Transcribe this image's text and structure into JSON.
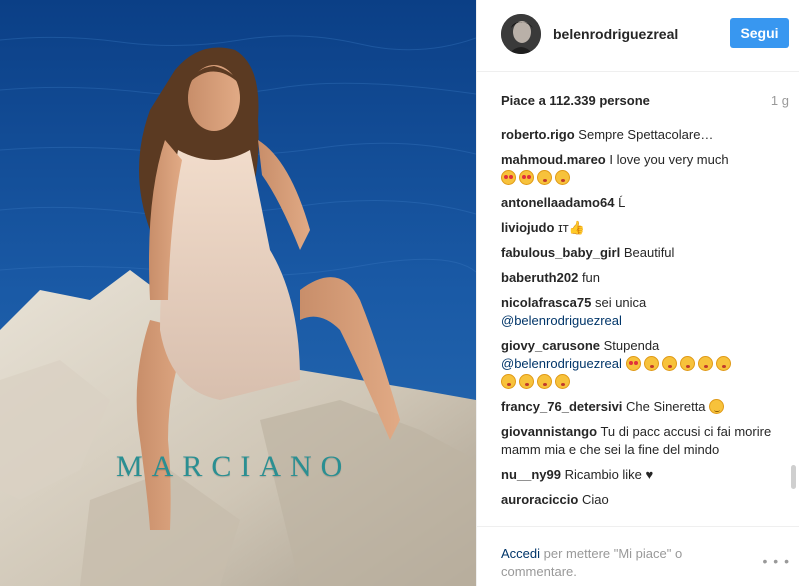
{
  "post": {
    "username": "belenrodriguezreal",
    "follow_label": "Segui",
    "likes_text": "Piace a 112.339 persone",
    "age": "1 g",
    "photo_brand": "MARCIANO"
  },
  "comments": [
    {
      "user": "roberto.rigo",
      "text": "Sempre Spettacolare…"
    },
    {
      "user": "mahmoud.mareo",
      "text": "I love you very much",
      "emojis": [
        "heart-eyes",
        "heart-eyes",
        "kiss",
        "kiss"
      ]
    },
    {
      "user": "antonellaadamo64",
      "text": "Ĺ"
    },
    {
      "user": "liviojudo",
      "text": "ɪᴛ"
    },
    {
      "user": "fabulous_baby_girl",
      "text": "Beautiful"
    },
    {
      "user": "baberuth202",
      "text": "fun"
    },
    {
      "user": "nicolafrasca75",
      "text": "sei unica",
      "mention": "@belenrodriguezreal"
    },
    {
      "user": "giovy_carusone",
      "text": "Stupenda",
      "mention": "@belenrodriguezreal"
    },
    {
      "user": "francy_76_detersivi",
      "text": "Che Sineretta"
    },
    {
      "user": "giovannistango",
      "text": "Tu di pacc accusi ci fai morire mamm mia e che sei la fine del mindo"
    },
    {
      "user": "nu__ny99",
      "text": "Ricambio like"
    },
    {
      "user": "auroraciccio",
      "text": "Ciao"
    }
  ],
  "footer": {
    "login_link": "Accedi",
    "login_rest": "per mettere \"Mi piace\" o commentare.",
    "more_label": "• • •"
  },
  "icons": {
    "more": "ellipsis-icon",
    "thumb": "thumbs-up-icon",
    "heart": "heart-icon"
  },
  "colors": {
    "follow_button": "#3897f0",
    "link": "#003569",
    "brand_watermark": "#2a8f92"
  }
}
